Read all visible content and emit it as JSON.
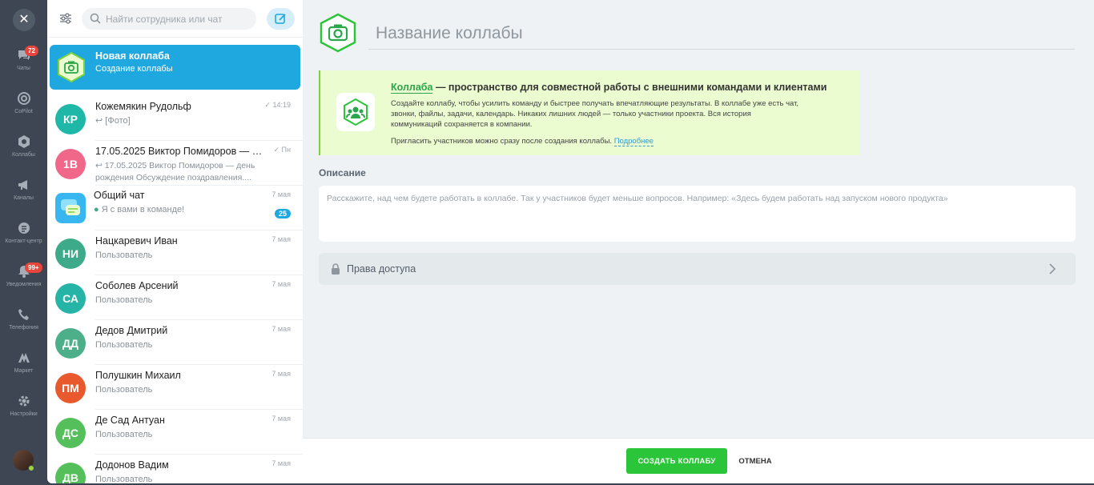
{
  "rail": {
    "items": [
      {
        "label": "Чаты",
        "icon": "chat-icon",
        "badge": "72"
      },
      {
        "label": "CoPilot",
        "icon": "copilot-icon"
      },
      {
        "label": "Коллабы",
        "icon": "collab-icon"
      },
      {
        "label": "Каналы",
        "icon": "megaphone-icon"
      },
      {
        "label": "Контакт-центр",
        "icon": "contact-center-icon"
      },
      {
        "label": "Уведомления",
        "icon": "bell-icon",
        "badge": "99+"
      },
      {
        "label": "Телефония",
        "icon": "phone-icon"
      },
      {
        "label": "Маркет",
        "icon": "market-icon"
      },
      {
        "label": "Настройки",
        "icon": "gear-icon"
      }
    ]
  },
  "search": {
    "placeholder": "Найти сотрудника или чат"
  },
  "chats": [
    {
      "name": "Новая коллаба",
      "sub": "Создание коллабы",
      "time": ""
    },
    {
      "name": "Кожемякин Рудольф",
      "initials": "КР",
      "sub": "[Фото]",
      "time": "14:19",
      "color": "#1eb7a8"
    },
    {
      "name": "17.05.2025 Виктор Помидоров — де...",
      "initials": "1В",
      "sub": "17.05.2025 Виктор Помидоров — день рождения Обсуждение поздравления....",
      "time": "Пн",
      "color": "#f06789"
    },
    {
      "name": "Общий чат",
      "sub": "Я с вами в команде!",
      "time": "7 мая",
      "badge": "25"
    },
    {
      "name": "Нацкаревич Иван",
      "initials": "НИ",
      "sub": "Пользователь",
      "time": "7 мая",
      "color": "#3daa8a"
    },
    {
      "name": "Соболев Арсений",
      "initials": "СА",
      "sub": "Пользователь",
      "time": "7 мая",
      "color": "#26b4a6"
    },
    {
      "name": "Дедов Дмитрий",
      "initials": "ДД",
      "sub": "Пользователь",
      "time": "7 мая",
      "color": "#4caf8a"
    },
    {
      "name": "Полушкин Михаил",
      "initials": "ПМ",
      "sub": "Пользователь",
      "time": "7 мая",
      "color": "#e85a2e"
    },
    {
      "name": "Де Сад Антуан",
      "initials": "ДС",
      "sub": "Пользователь",
      "time": "7 мая",
      "color": "#55c05b"
    },
    {
      "name": "Додонов Вадим",
      "initials": "ДВ",
      "sub": "Пользователь",
      "time": "7 мая",
      "color": "#55c05b"
    }
  ],
  "main": {
    "title_placeholder": "Название коллабы",
    "info": {
      "link": "Коллаба",
      "heading_rest": " — пространство для совместной работы с внешними командами и клиентами",
      "description": "Создайте коллабу, чтобы усилить команду и быстрее получать впечатляющие результаты. В коллабе уже есть чат, звонки, файлы, задачи, календарь. Никаких лишних людей — только участники проекта. Вся история коммуникаций сохраняется в компании.",
      "invite": "Пригласить участников можно сразу после создания коллабы. ",
      "more": "Подробнее"
    },
    "description_label": "Описание",
    "description_placeholder": "Расскажите, над чем будете работать в коллабе. Так у участников будет меньше вопросов. Например: «Здесь будем работать над запуском нового продукта»",
    "access_label": "Права доступа"
  },
  "footer": {
    "create": "СОЗДАТЬ КОЛЛАБУ",
    "cancel": "ОТМЕНА"
  },
  "colors": {
    "accent": "#1fa8e0",
    "create": "#2bc53a",
    "info_bg": "#eafcd0"
  }
}
